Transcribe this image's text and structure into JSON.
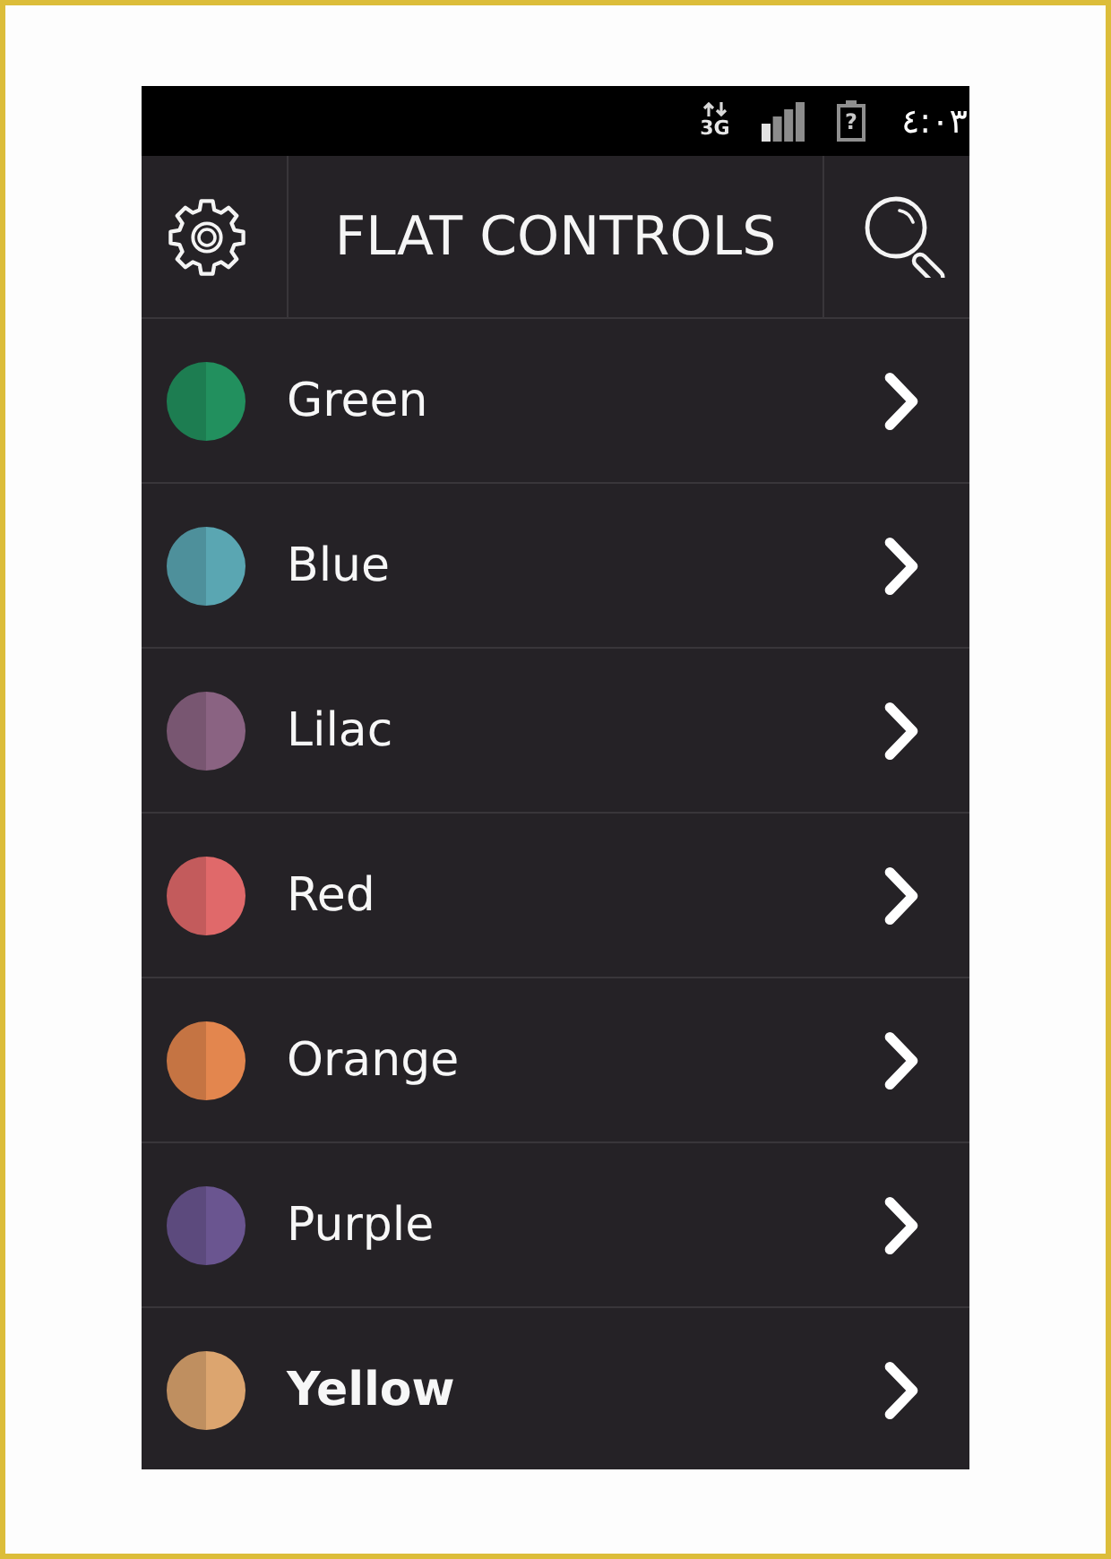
{
  "status_bar": {
    "network": "3G",
    "battery_symbol": "?",
    "time": "٤:٠٣"
  },
  "header": {
    "title": "FLAT CONTROLS"
  },
  "items": [
    {
      "label": "Green",
      "color": "#22905e",
      "bold": false
    },
    {
      "label": "Blue",
      "color": "#5aa6b2",
      "bold": false
    },
    {
      "label": "Lilac",
      "color": "#8a6382",
      "bold": false
    },
    {
      "label": "Red",
      "color": "#e0696a",
      "bold": false
    },
    {
      "label": "Orange",
      "color": "#e3864e",
      "bold": false
    },
    {
      "label": "Purple",
      "color": "#6a5590",
      "bold": false
    },
    {
      "label": "Yellow",
      "color": "#dca56f",
      "bold": true
    }
  ]
}
